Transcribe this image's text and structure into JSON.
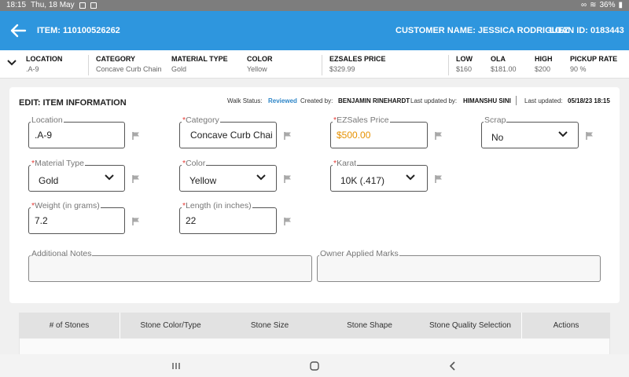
{
  "status_bar": {
    "time": "18:15",
    "date": "Thu, 18 May",
    "battery": "36%"
  },
  "header": {
    "item": "ITEM: 110100526262",
    "customer": "CUSTOMER NAME: JESSICA RODRIGUEZ",
    "loan": "LOAN ID: 0183443"
  },
  "summary": [
    {
      "label": "LOCATION",
      "value": ".A-9"
    },
    {
      "label": "CATEGORY",
      "value": "Concave Curb Chain"
    },
    {
      "label": "MATERIAL TYPE",
      "value": "Gold"
    },
    {
      "label": "COLOR",
      "value": "Yellow"
    },
    {
      "label": "EZSALES PRICE",
      "value": "$329.99"
    },
    {
      "label": "LOW",
      "value": "$160"
    },
    {
      "label": "OLA",
      "value": "$181.00"
    },
    {
      "label": "HIGH",
      "value": "$200"
    },
    {
      "label": "PICKUP RATE",
      "value": "90 %"
    }
  ],
  "edit": {
    "title": "EDIT: ITEM INFORMATION",
    "walk_status_label": "Walk Status:",
    "walk_status": "Reviewed",
    "created_by_label": "Created by:",
    "created_by": "BENJAMIN RINEHARDT",
    "updated_by_label": "Last updated by:",
    "updated_by": "HIMANSHU SINI",
    "last_updated_label": "Last updated:",
    "last_updated": "05/18/23 18:15"
  },
  "fields": {
    "location": {
      "label": "Location",
      "value": ".A-9"
    },
    "category": {
      "label": "Category",
      "value": "Concave Curb Chai"
    },
    "ezsales_price": {
      "label": "EZSales Price",
      "value": "$500.00"
    },
    "scrap": {
      "label": "Scrap",
      "value": "No"
    },
    "material_type": {
      "label": "Material Type",
      "value": "Gold"
    },
    "color": {
      "label": "Color",
      "value": "Yellow"
    },
    "karat": {
      "label": "Karat",
      "value": "10K (.417)"
    },
    "weight": {
      "label": "Weight (in grams)",
      "value": "7.2"
    },
    "length": {
      "label": "Length (in inches)",
      "value": "22"
    },
    "additional_notes": {
      "label": "Additional Notes",
      "value": ""
    },
    "owner_marks": {
      "label": "Owner Applied Marks",
      "value": ""
    }
  },
  "required_marker": "*",
  "stones_table": {
    "headers": [
      "# of Stones",
      "Stone Color/Type",
      "Stone Size",
      "Stone Shape",
      "Stone Quality Selection",
      "Actions"
    ]
  },
  "colors": {
    "primary": "#2e96de",
    "accent_orange": "#e69100",
    "required": "#e53935"
  }
}
